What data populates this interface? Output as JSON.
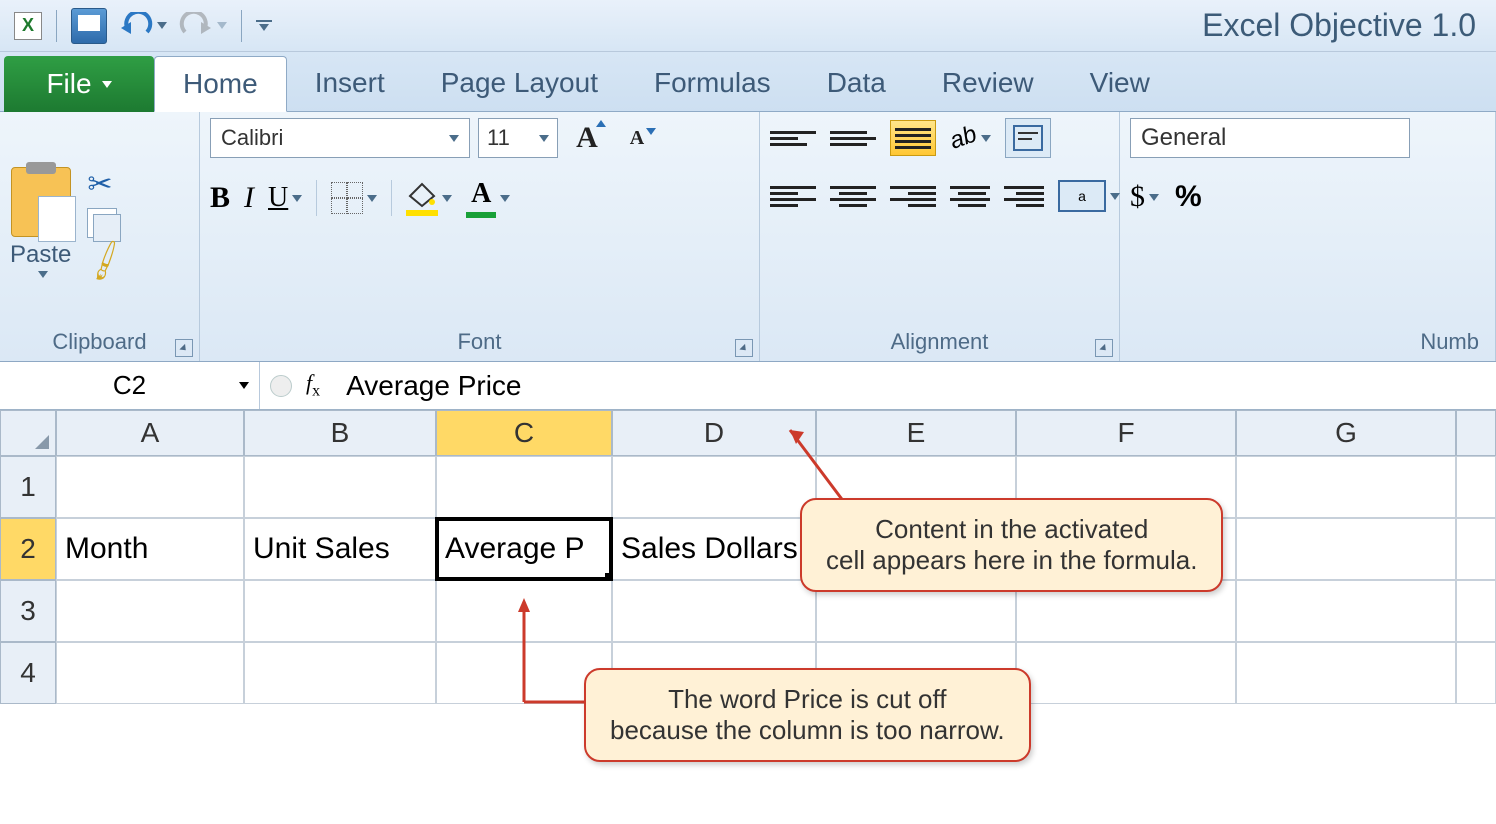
{
  "title": "Excel Objective 1.0",
  "qat": {
    "excel_icon": "X",
    "save": "save-icon",
    "undo": "undo-icon",
    "redo": "redo-icon"
  },
  "tabs": {
    "file": "File",
    "items": [
      "Home",
      "Insert",
      "Page Layout",
      "Formulas",
      "Data",
      "Review",
      "View"
    ],
    "active": "Home"
  },
  "ribbon": {
    "clipboard": {
      "paste": "Paste",
      "label": "Clipboard"
    },
    "font": {
      "name": "Calibri",
      "size": "11",
      "grow": "A",
      "shrink": "A",
      "bold": "B",
      "italic": "I",
      "underline": "U",
      "label": "Font"
    },
    "alignment": {
      "label": "Alignment",
      "merge": "a"
    },
    "number": {
      "format": "General",
      "dollar": "$",
      "percent": "%",
      "label": "Numb"
    }
  },
  "formula_bar": {
    "name_box": "C2",
    "fx": "fx",
    "content": "Average Price"
  },
  "grid": {
    "columns": [
      "A",
      "B",
      "C",
      "D",
      "E",
      "F",
      "G"
    ],
    "active_col": "C",
    "rows": [
      "1",
      "2",
      "3",
      "4"
    ],
    "active_row": "2",
    "cells": {
      "A2": "Month",
      "B2": "Unit Sales",
      "C2": "Average P",
      "D2": "Sales Dollars"
    },
    "selected": "C2"
  },
  "callouts": {
    "c1": "Content in the activated\ncell appears here in the formula.",
    "c2": "The word Price is cut off\nbecause the column is too narrow."
  }
}
